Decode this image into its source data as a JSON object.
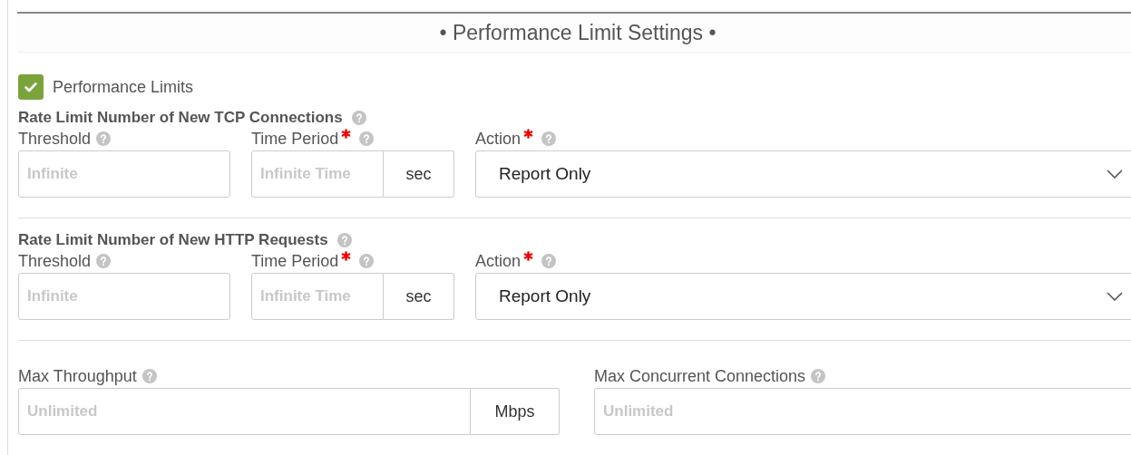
{
  "title": "• Performance Limit Settings •",
  "performance_limits": {
    "label": "Performance Limits",
    "checked": true
  },
  "sections": [
    {
      "heading": "Rate Limit Number of New TCP Connections",
      "threshold": {
        "label": "Threshold",
        "required": false,
        "placeholder": "Infinite"
      },
      "time_period": {
        "label": "Time Period",
        "required": true,
        "placeholder": "Infinite Time",
        "unit": "sec"
      },
      "action": {
        "label": "Action",
        "required": true,
        "value": "Report Only"
      }
    },
    {
      "heading": "Rate Limit Number of New HTTP Requests",
      "threshold": {
        "label": "Threshold",
        "required": false,
        "placeholder": "Infinite"
      },
      "time_period": {
        "label": "Time Period",
        "required": true,
        "placeholder": "Infinite Time",
        "unit": "sec"
      },
      "action": {
        "label": "Action",
        "required": true,
        "value": "Report Only"
      }
    }
  ],
  "max_throughput": {
    "label": "Max Throughput",
    "required": false,
    "placeholder": "Unlimited",
    "unit": "Mbps"
  },
  "max_concurrent_connections": {
    "label": "Max Concurrent Connections",
    "required": false,
    "placeholder": "Unlimited"
  }
}
